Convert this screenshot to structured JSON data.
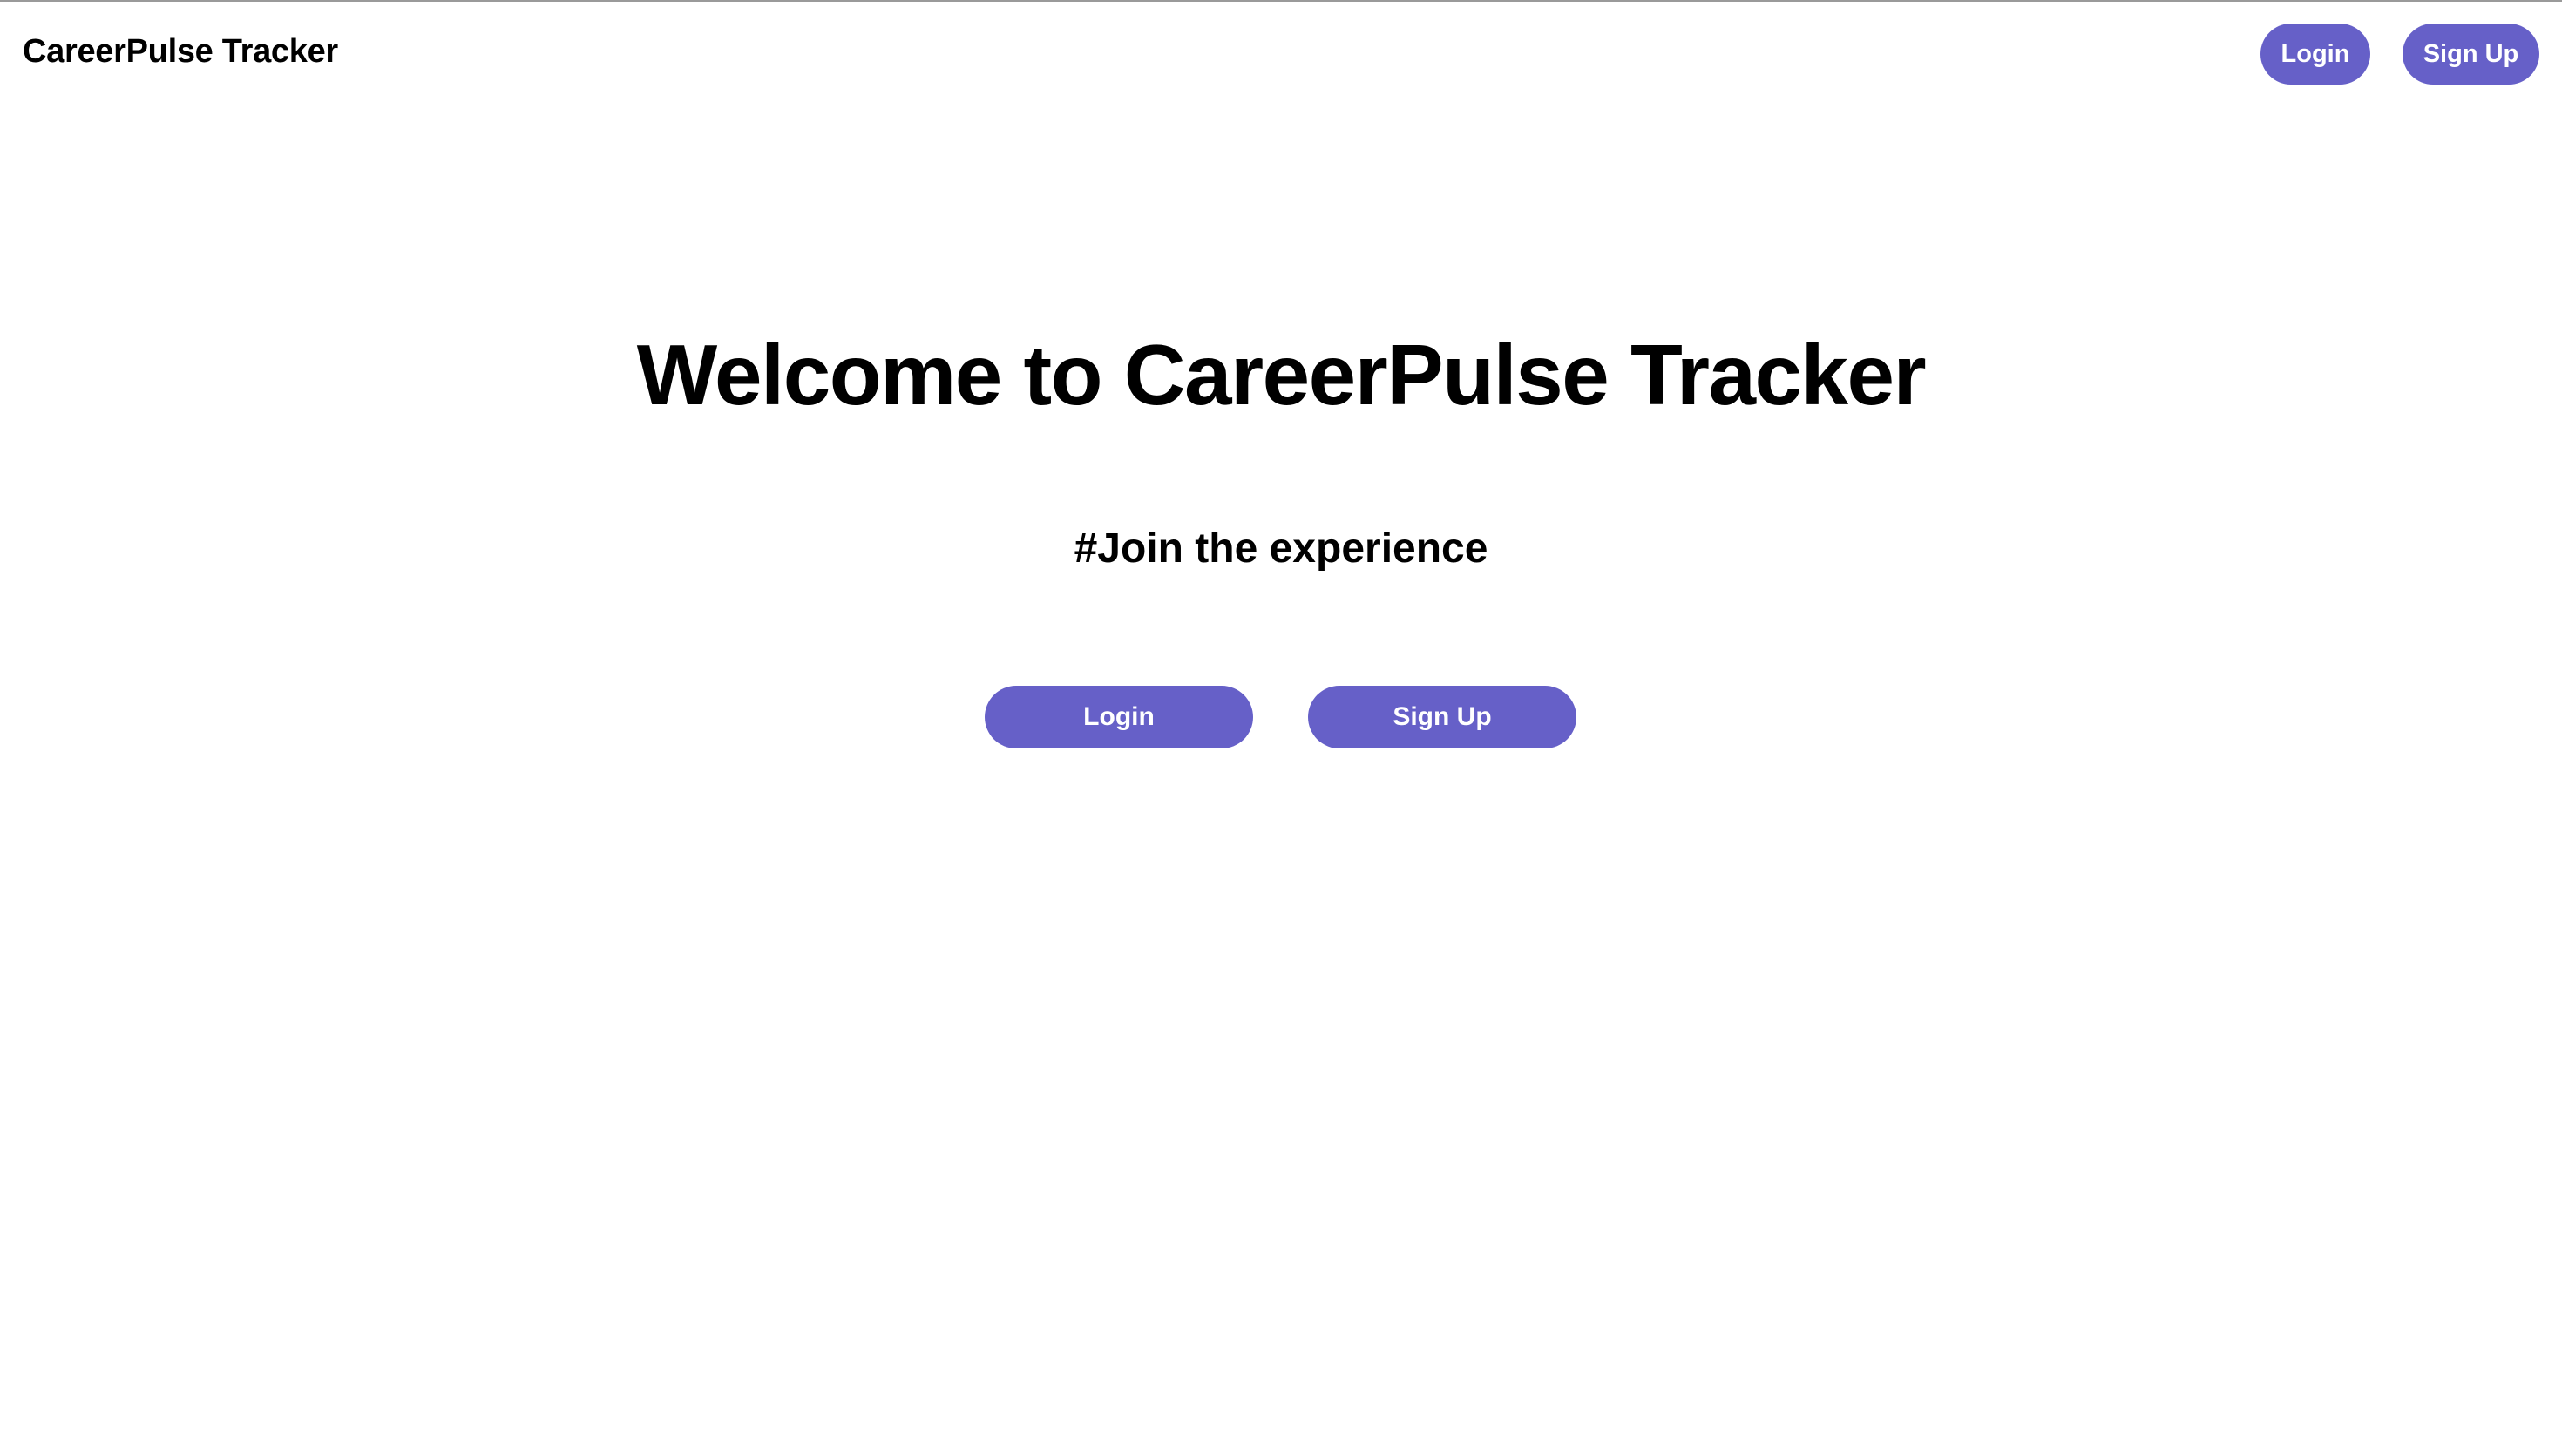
{
  "header": {
    "brand": "CareerPulse Tracker",
    "login_label": "Login",
    "signup_label": "Sign Up"
  },
  "hero": {
    "title": "Welcome to CareerPulse Tracker",
    "tagline": "#Join the experience",
    "login_label": "Login",
    "signup_label": "Sign Up"
  },
  "colors": {
    "accent": "#6660c8",
    "button_text": "#ffffff",
    "background": "#ffffff",
    "text": "#000000"
  }
}
